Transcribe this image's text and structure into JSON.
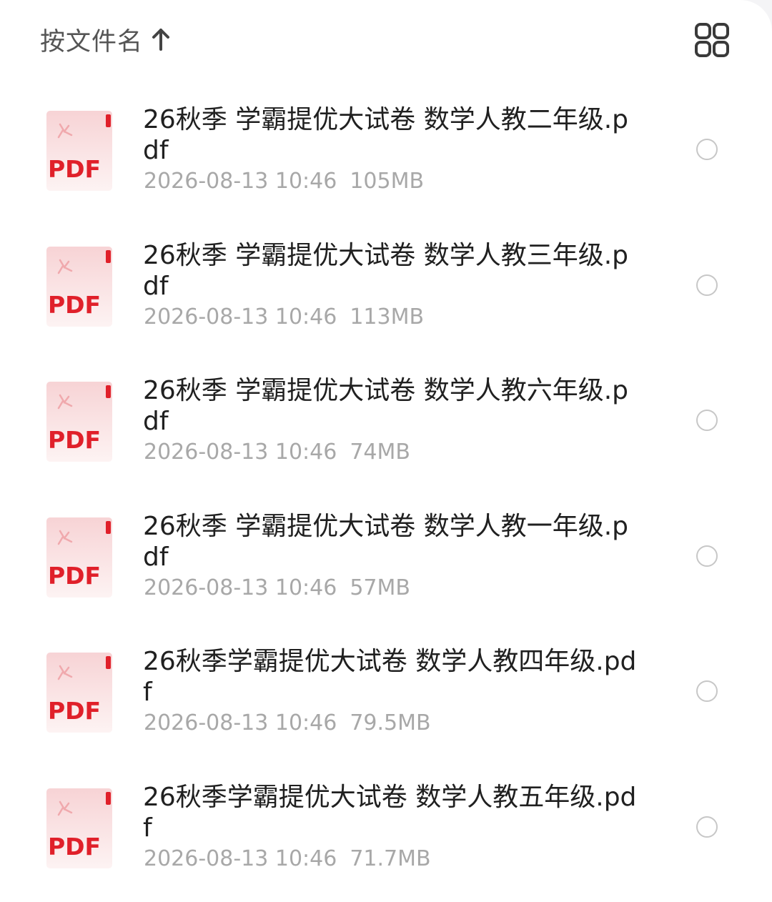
{
  "header": {
    "sort_label": "按文件名",
    "sort_icon": "arrow-up-icon",
    "view_icon": "grid-view-icon"
  },
  "colors": {
    "pdf_red": "#e0202a",
    "pdf_bg": "#fbe9ea",
    "radio_border": "#c7c7c7",
    "meta_text": "#a8a8a8",
    "name_text": "#202020"
  },
  "file_icon": {
    "badge_text": "PDF",
    "icon": "pdf-file-icon"
  },
  "files": [
    {
      "name": "26秋季 学霸提优大试卷  数学人教二年级.pdf",
      "date": "2026-08-13 10:46",
      "size": "105MB"
    },
    {
      "name": "26秋季 学霸提优大试卷  数学人教三年级.pdf",
      "date": "2026-08-13 10:46",
      "size": "113MB"
    },
    {
      "name": "26秋季 学霸提优大试卷  数学人教六年级.pdf",
      "date": "2026-08-13 10:46",
      "size": "74MB"
    },
    {
      "name": "26秋季 学霸提优大试卷 数学人教一年级.pdf",
      "date": "2026-08-13 10:46",
      "size": "57MB"
    },
    {
      "name": "26秋季学霸提优大试卷  数学人教四年级.pdf",
      "date": "2026-08-13 10:46",
      "size": "79.5MB"
    },
    {
      "name": "26秋季学霸提优大试卷  数学人教五年级.pdf",
      "date": "2026-08-13 10:46",
      "size": "71.7MB"
    }
  ]
}
